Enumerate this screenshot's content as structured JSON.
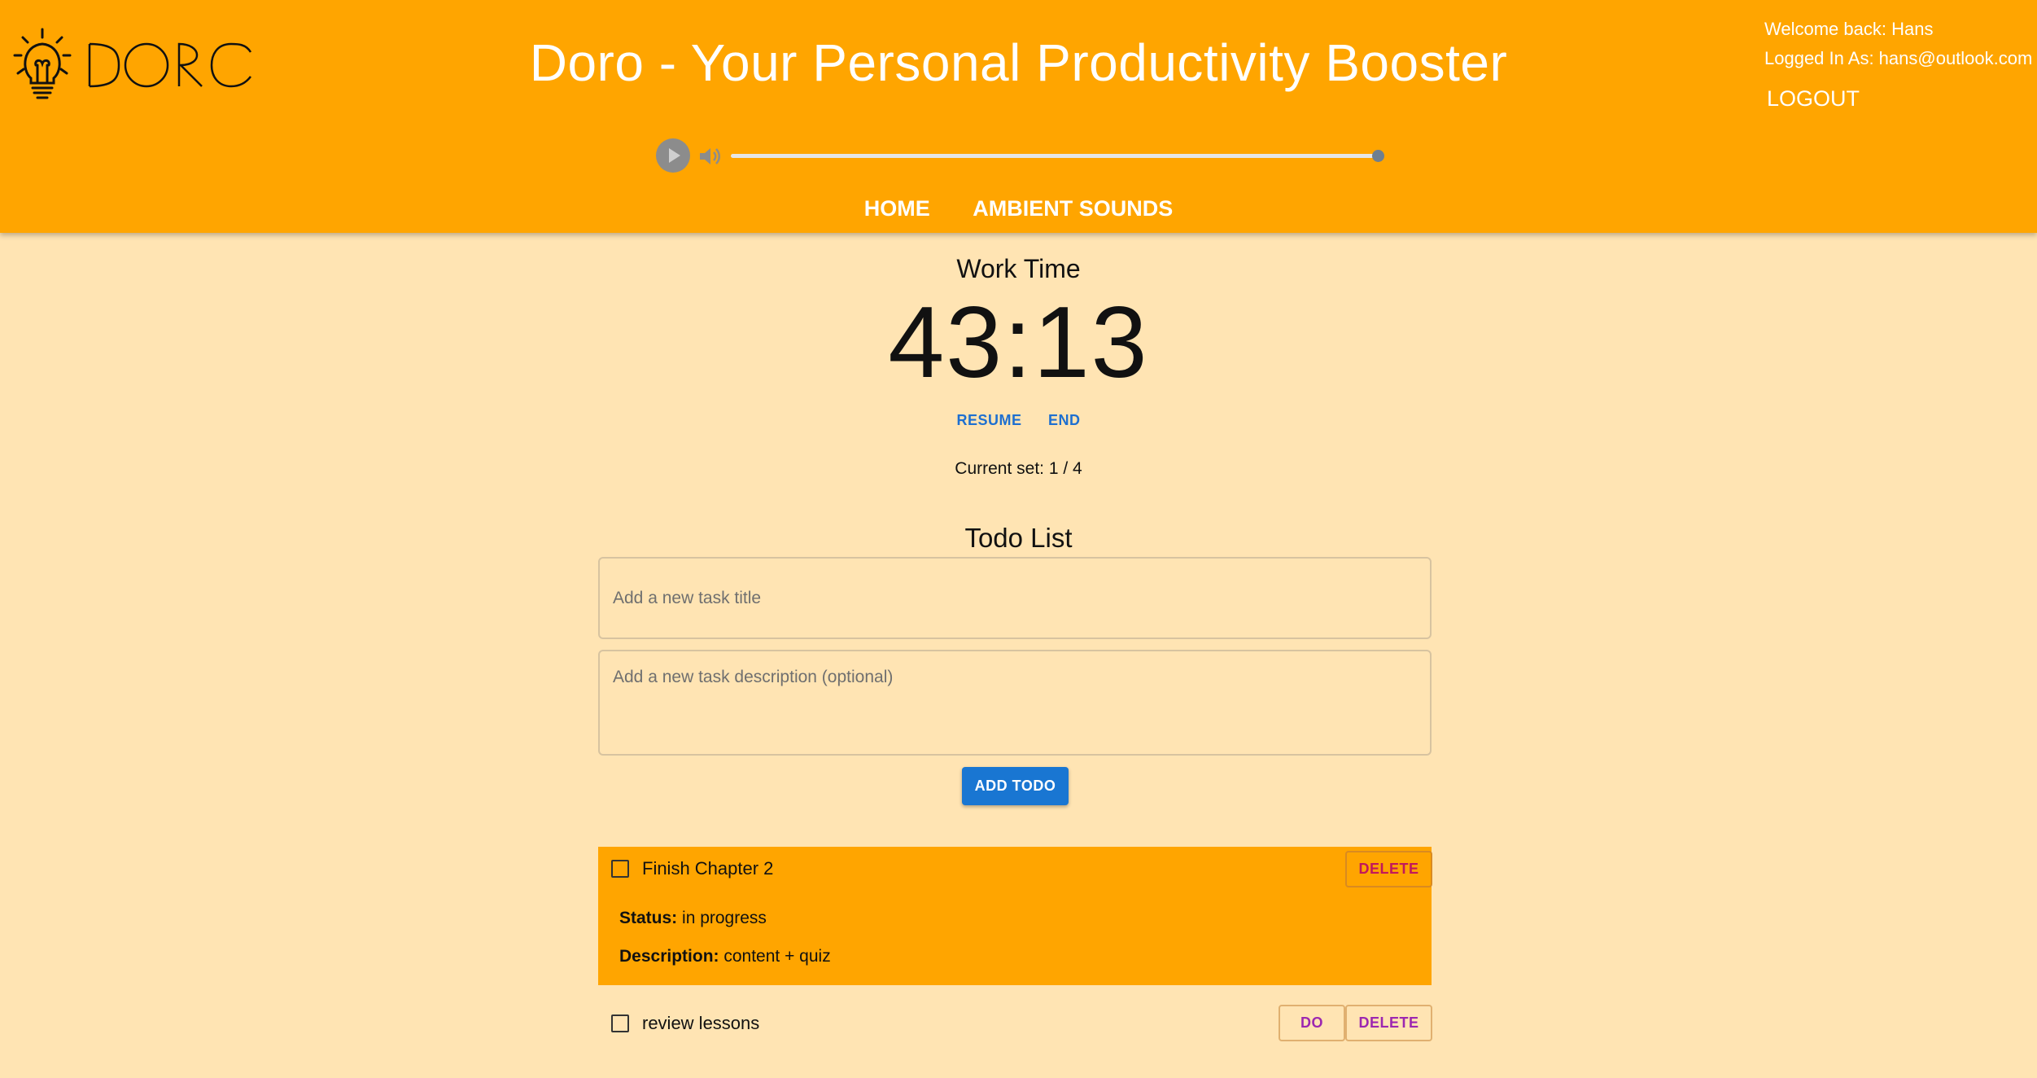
{
  "header": {
    "logo_alt": "DORO",
    "app_title": "Doro - Your Personal Productivity Booster",
    "welcome": "Welcome back: Hans",
    "logged_in": "Logged In As: hans@outlook.com",
    "logout_label": "LOGOUT",
    "colors": {
      "background": "#ffa500",
      "text": "#ffffff"
    }
  },
  "player": {
    "state": "paused",
    "volume_level": 1.0
  },
  "nav": {
    "items": [
      {
        "label": "HOME"
      },
      {
        "label": "AMBIENT SOUNDS"
      }
    ]
  },
  "timer": {
    "mode_label": "Work Time",
    "time": "43:13",
    "resume_label": "RESUME",
    "end_label": "END",
    "set_label": "Current set:",
    "set_value": "1 / 4"
  },
  "todo": {
    "heading": "Todo List",
    "title_placeholder": "Add a new task title",
    "description_placeholder": "Add a new task description (optional)",
    "add_label": "ADD TODO",
    "items": [
      {
        "title": "Finish Chapter 2",
        "status_label": "Status:",
        "status": "in progress",
        "description_label": "Description:",
        "description": "content + quiz",
        "delete_label": "DELETE",
        "active": true
      },
      {
        "title": "review lessons",
        "do_label": "DO",
        "delete_label": "DELETE",
        "active": false
      }
    ]
  },
  "colors": {
    "page_background": "#ffe4b3",
    "accent_primary": "#1976d2",
    "active_task": "#ffa500"
  }
}
